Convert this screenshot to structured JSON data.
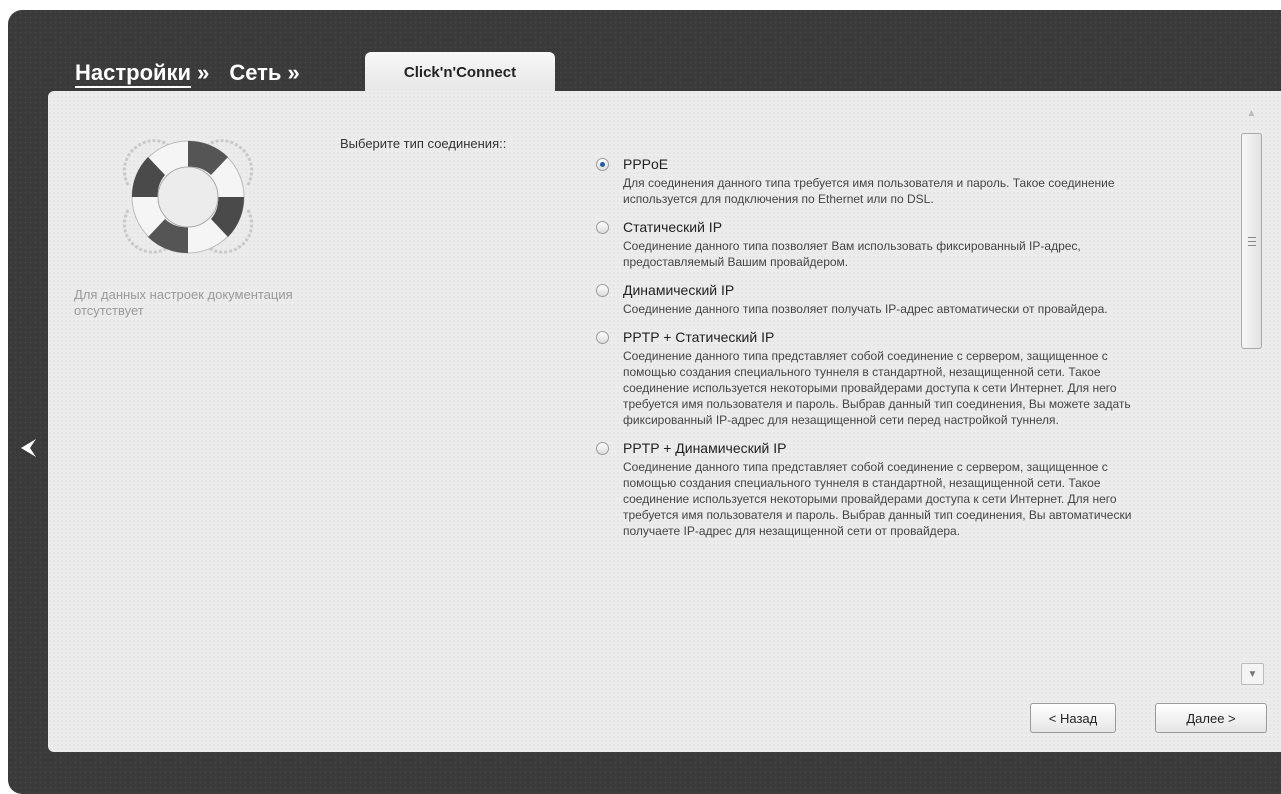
{
  "breadcrumb": {
    "items": [
      {
        "label": "Настройки"
      },
      {
        "label": "Сеть"
      }
    ],
    "separator": "»",
    "current_tab": "Click'n'Connect"
  },
  "help": {
    "text": "Для данных настроек документация отсутствует",
    "icon": "lifebuoy-icon"
  },
  "form": {
    "prompt": "Выберите тип соединения::",
    "options": [
      {
        "label": "PPPoE",
        "checked": true,
        "description": "Для соединения данного типа требуется имя пользователя и пароль. Такое соединение используется для подключения по Ethernet или по DSL."
      },
      {
        "label": "Статический IP",
        "checked": false,
        "description": "Соединение данного типа позволяет Вам использовать фиксированный IP-адрес, предоставляемый Вашим провайдером."
      },
      {
        "label": "Динамический IP",
        "checked": false,
        "description": "Соединение данного типа позволяет получать IP-адрес автоматически от провайдера."
      },
      {
        "label": "PPTP + Статический IP",
        "checked": false,
        "description": "Соединение данного типа представляет собой соединение с сервером, защищенное с помощью создания специального туннеля в стандартной, незащищенной сети. Такое соединение используется некоторыми провайдерами доступа к сети Интернет. Для него требуется имя пользователя и пароль. Выбрав данный тип соединения, Вы можете задать фиксированный IP-адрес для незащищенной сети перед настройкой туннеля."
      },
      {
        "label": "PPTP + Динамический IP",
        "checked": false,
        "description": "Соединение данного типа представляет собой соединение с сервером, защищенное с помощью создания специального туннеля в стандартной, незащищенной сети. Такое соединение используется некоторыми провайдерами доступа к сети Интернет. Для него требуется имя пользователя и пароль. Выбрав данный тип соединения, Вы автоматически получаете IP-адрес для незащищенной сети от провайдера."
      }
    ]
  },
  "buttons": {
    "back": "< Назад",
    "next": "Далее >"
  },
  "nav": {
    "collapse_icon": "chevron-left-icon"
  },
  "colors": {
    "frame": "#3a3a3a",
    "panel": "#ececec",
    "radio_selected": "#1d5fa8"
  }
}
